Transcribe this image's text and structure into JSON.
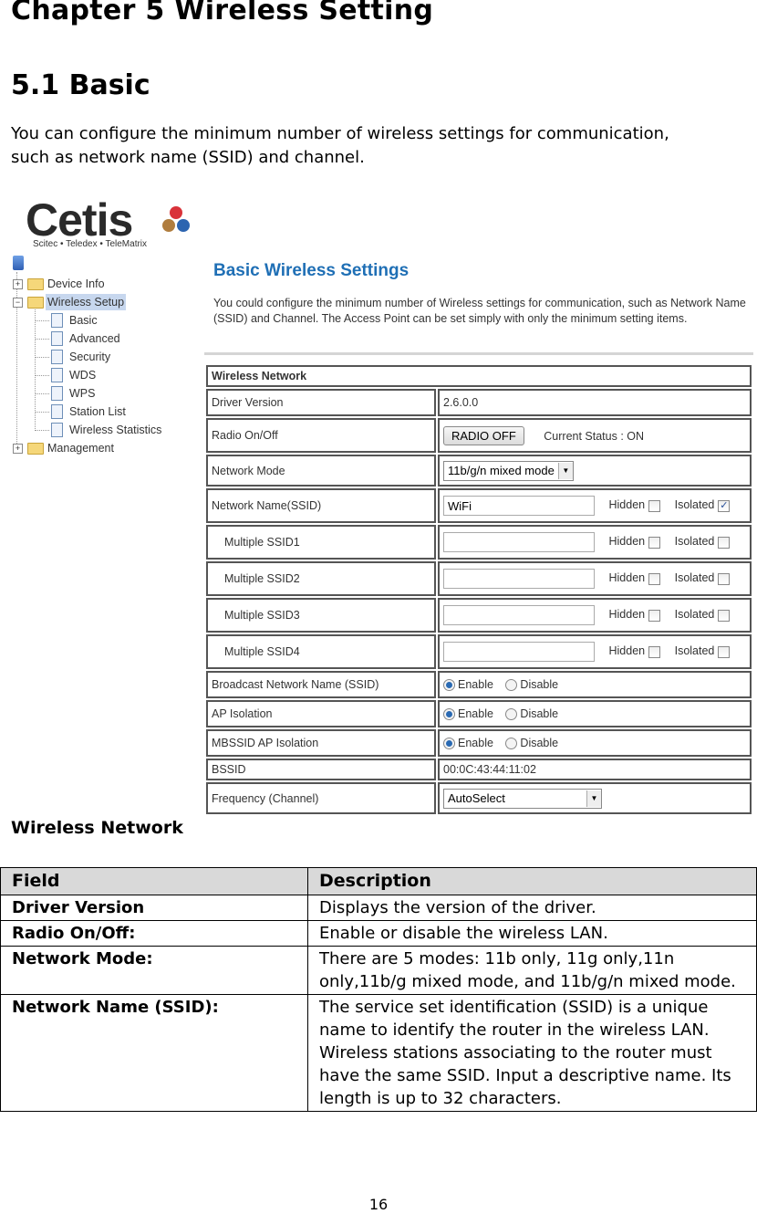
{
  "chapter_title": "Chapter 5  Wireless Setting",
  "section_title": "5.1  Basic",
  "intro": "You can configure the minimum number of wireless settings for communication, such as network name (SSID) and channel.",
  "screenshot": {
    "logo": {
      "word": "Cetis",
      "tagline": "Scitec • Teledex • TeleMatrix",
      "dot_colors": [
        "#d9333a",
        "#b07d3e",
        "#2c64b0"
      ]
    },
    "tree": {
      "items": [
        {
          "label": "Device Info",
          "type": "folder",
          "expanded": false
        },
        {
          "label": "Wireless Setup",
          "type": "folder",
          "expanded": true,
          "selected": true
        },
        {
          "label": "Basic",
          "type": "page"
        },
        {
          "label": "Advanced",
          "type": "page"
        },
        {
          "label": "Security",
          "type": "page"
        },
        {
          "label": "WDS",
          "type": "page"
        },
        {
          "label": "WPS",
          "type": "page"
        },
        {
          "label": "Station List",
          "type": "page"
        },
        {
          "label": "Wireless Statistics",
          "type": "page"
        },
        {
          "label": "Management",
          "type": "folder",
          "expanded": false
        }
      ]
    },
    "page_title": "Basic Wireless Settings",
    "page_desc": "You could configure the minimum number of Wireless settings for communication, such as Network Name (SSID) and Channel. The Access Point can be set simply with only the minimum setting items.",
    "accent_color": "#1f6fb5",
    "table": {
      "header": "Wireless Network",
      "driver_version": {
        "label": "Driver Version",
        "value": "2.6.0.0"
      },
      "radio": {
        "label": "Radio On/Off",
        "button": "RADIO OFF",
        "status": "Current Status : ON"
      },
      "network_mode": {
        "label": "Network Mode",
        "selected": "11b/g/n mixed mode"
      },
      "ssid": {
        "label": "Network Name(SSID)",
        "value": "WiFi",
        "hidden_label": "Hidden",
        "hidden": false,
        "isolated_label": "Isolated",
        "isolated": true
      },
      "mssid": [
        {
          "label": "Multiple SSID1",
          "value": "",
          "hidden_label": "Hidden",
          "hidden": false,
          "isolated_label": "Isolated",
          "isolated": false
        },
        {
          "label": "Multiple SSID2",
          "value": "",
          "hidden_label": "Hidden",
          "hidden": false,
          "isolated_label": "Isolated",
          "isolated": false
        },
        {
          "label": "Multiple SSID3",
          "value": "",
          "hidden_label": "Hidden",
          "hidden": false,
          "isolated_label": "Isolated",
          "isolated": false
        },
        {
          "label": "Multiple SSID4",
          "value": "",
          "hidden_label": "Hidden",
          "hidden": false,
          "isolated_label": "Isolated",
          "isolated": false
        }
      ],
      "broadcast": {
        "label": "Broadcast Network Name (SSID)",
        "enable": "Enable",
        "disable": "Disable",
        "selected": "Enable"
      },
      "ap_isolation": {
        "label": "AP Isolation",
        "enable": "Enable",
        "disable": "Disable",
        "selected": "Enable"
      },
      "mbssid_isolation": {
        "label": "MBSSID AP Isolation",
        "enable": "Enable",
        "disable": "Disable",
        "selected": "Enable"
      },
      "bssid": {
        "label": "BSSID",
        "value": "00:0C:43:44:11:02"
      },
      "frequency": {
        "label": "Frequency (Channel)",
        "selected": "AutoSelect"
      }
    }
  },
  "subheading": "Wireless Network",
  "desc_table": {
    "headers": [
      "Field",
      "Description"
    ],
    "rows": [
      {
        "field": "Driver Version",
        "description": "Displays the version of the driver."
      },
      {
        "field": "Radio On/Off:",
        "description": "Enable or disable the wireless LAN."
      },
      {
        "field": "Network Mode:",
        "description": "There are 5 modes: 11b only, 11g only,11n only,11b/g mixed mode, and 11b/g/n mixed mode."
      },
      {
        "field": "Network Name (SSID):",
        "description": "The service set identification (SSID) is a unique name to identify the router in the wireless LAN. Wireless stations associating to the router must have the same SSID. Input a descriptive name. Its length is up to 32 characters."
      }
    ]
  },
  "page_number": "16"
}
